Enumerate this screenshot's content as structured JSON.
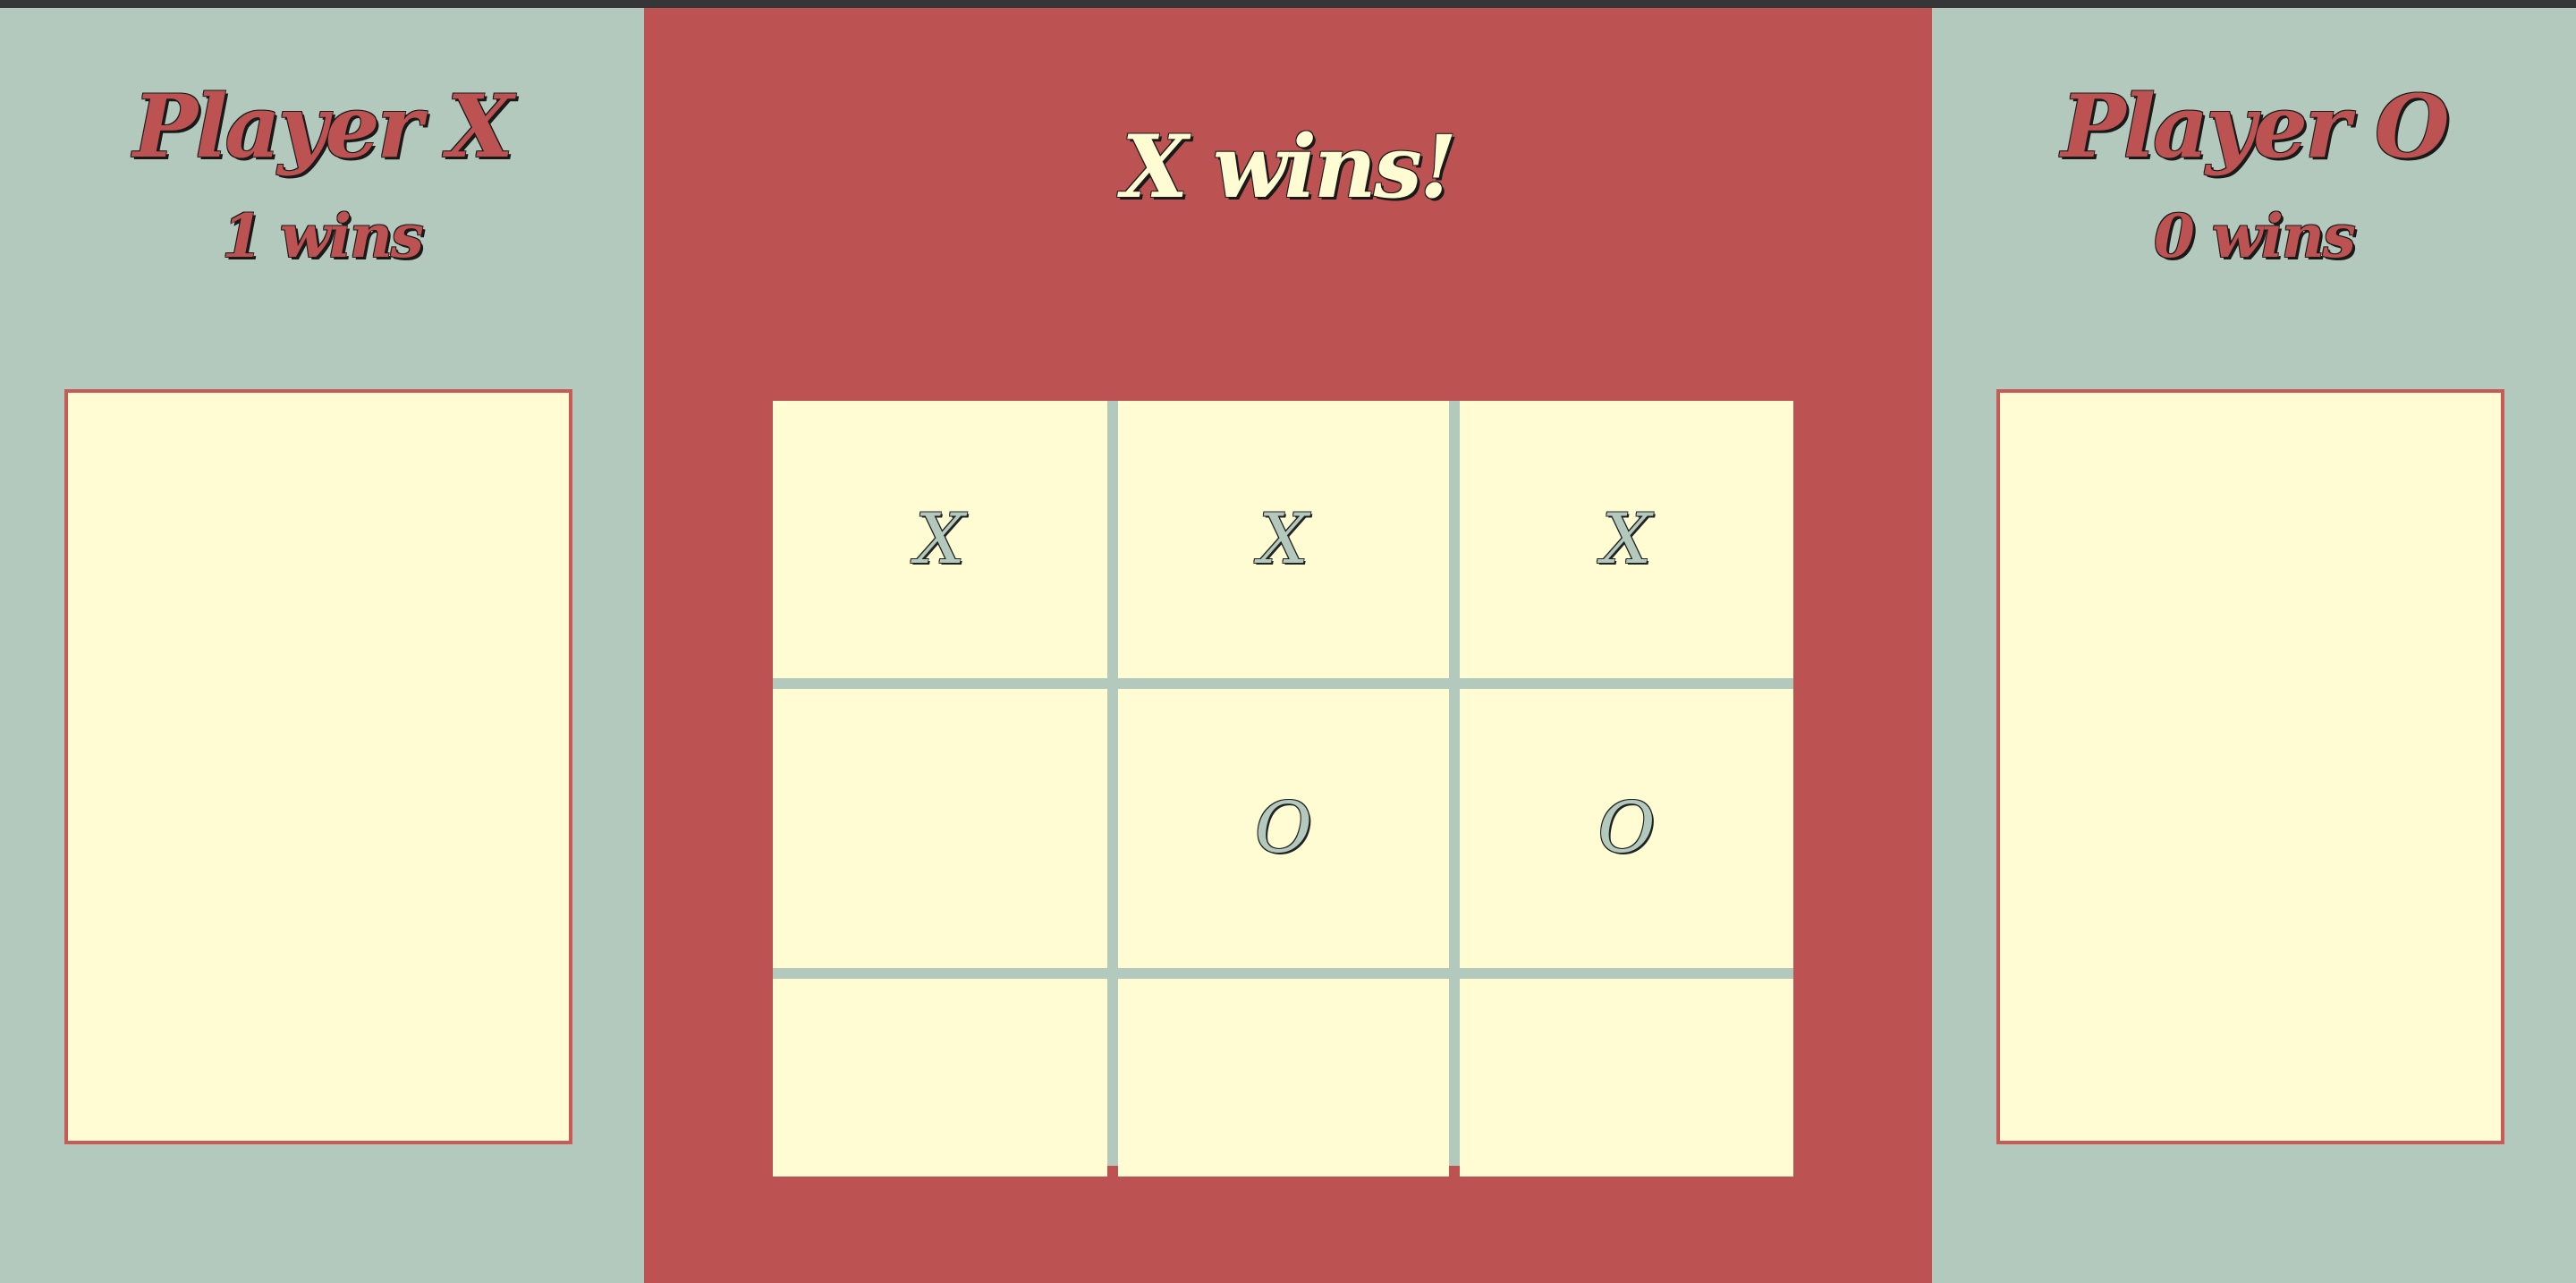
{
  "players": {
    "x": {
      "name": "Player X",
      "wins": "1 wins"
    },
    "o": {
      "name": "Player O",
      "wins": "0 wins"
    }
  },
  "status": "X wins!",
  "board": [
    [
      "X",
      "X",
      "X"
    ],
    [
      "",
      "O",
      "O"
    ],
    [
      "",
      "",
      ""
    ]
  ],
  "colors": {
    "side_bg": "#b3c9bd",
    "center_bg": "#bc5352",
    "cell_bg": "#fffbd3",
    "accent": "#bc5352"
  }
}
